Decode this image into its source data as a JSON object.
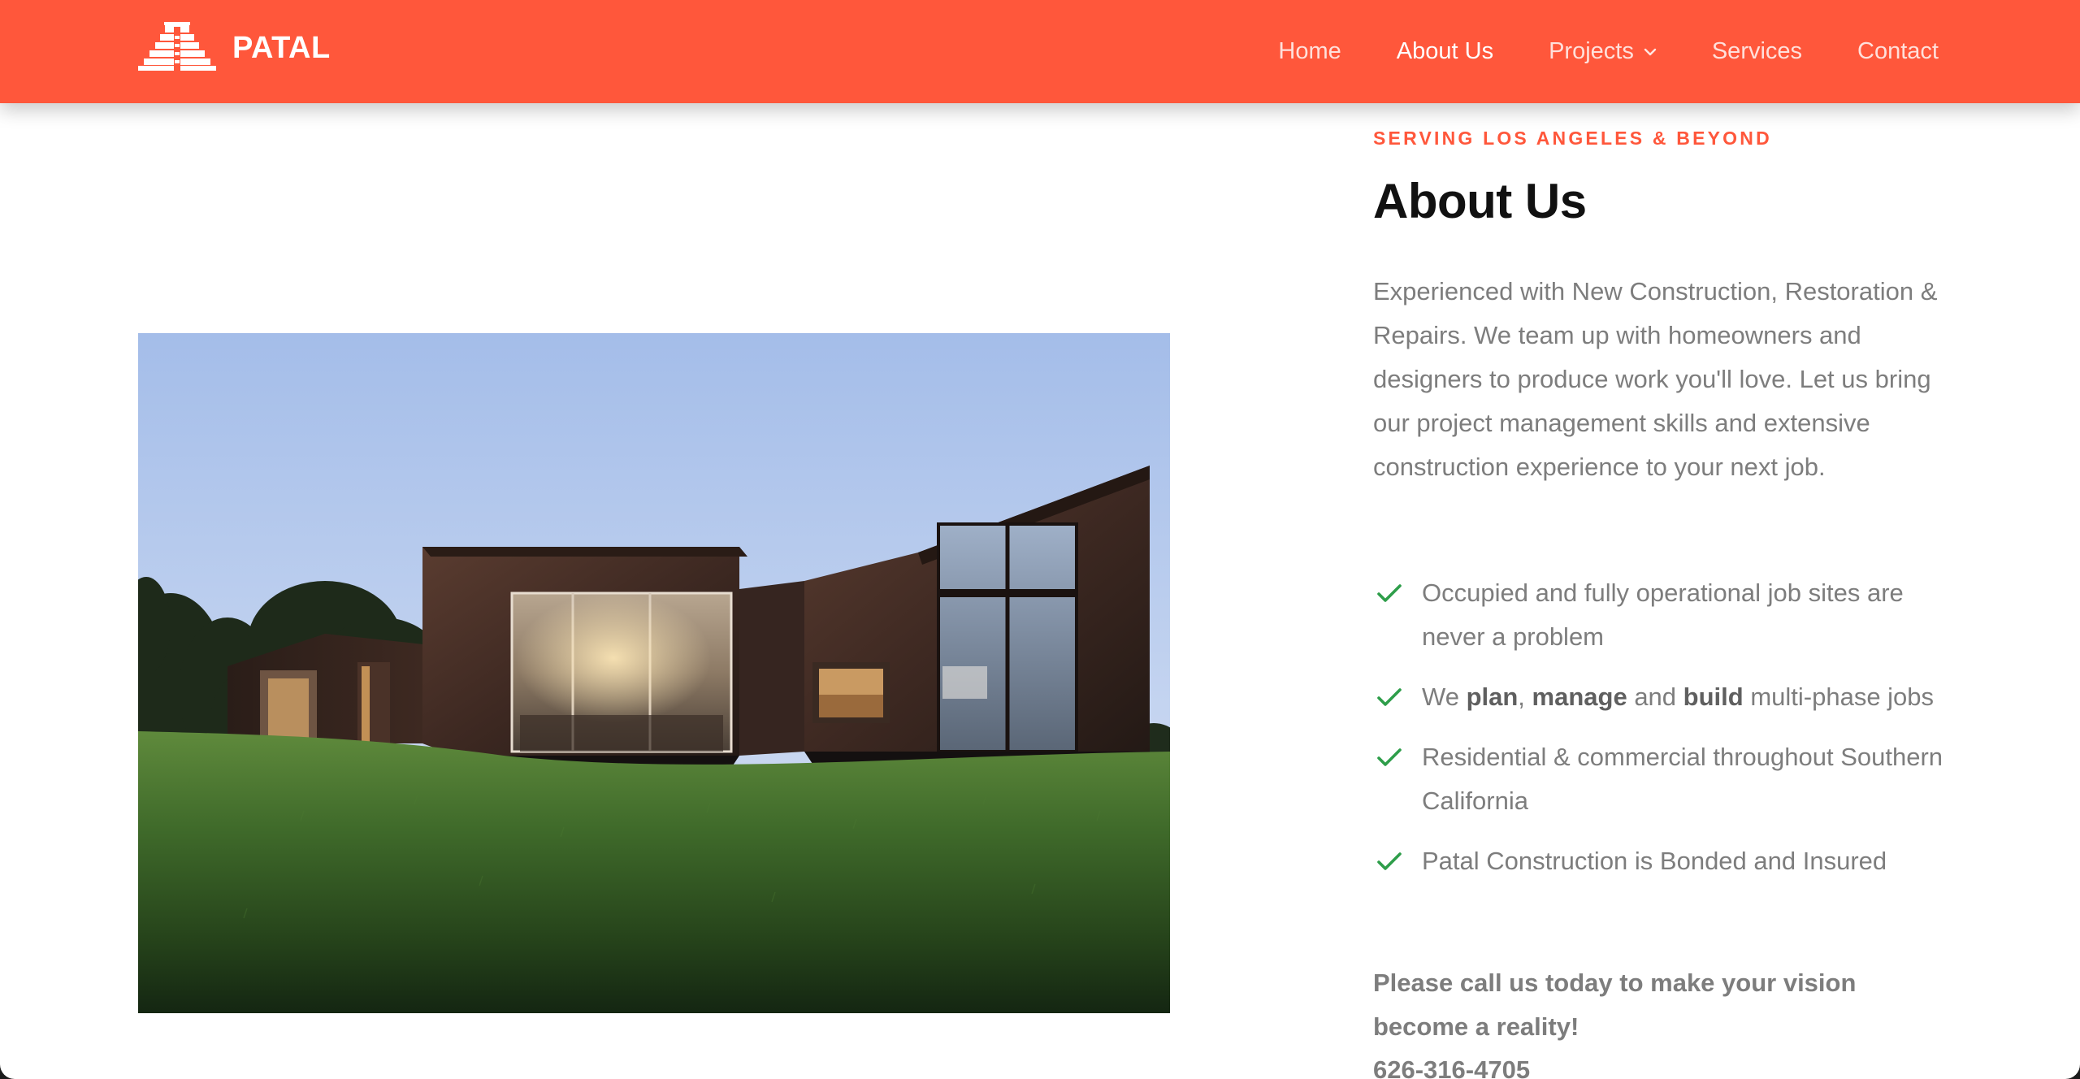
{
  "brand": {
    "name": "PATAL",
    "logo_icon": "pyramid-logo-icon",
    "color": "#ff573b"
  },
  "nav": {
    "items": [
      {
        "label": "Home",
        "active": false
      },
      {
        "label": "About Us",
        "active": true
      },
      {
        "label": "Projects",
        "active": false,
        "has_dropdown": true,
        "dropdown_icon": "chevron-down-icon"
      },
      {
        "label": "Services",
        "active": false
      },
      {
        "label": "Contact",
        "active": false
      }
    ]
  },
  "hero_image": {
    "subject": "modern dark-clad house on grassy hill at dusk"
  },
  "about": {
    "eyebrow": "SERVING LOS ANGELES & BEYOND",
    "title": "About Us",
    "intro": "Experienced with New Construction, Restoration & Repairs. We team up with homeowners and designers to produce work you'll love. Let us bring our project management skills and extensive construction experience to your next job.",
    "checklist_icon": "checkmark-icon",
    "check_color": "#2e9e4a",
    "checklist": [
      {
        "text": "Occupied and fully operational job sites are never a problem"
      },
      {
        "parts": [
          "We ",
          "plan",
          ", ",
          "manage",
          " and ",
          "build",
          " multi-phase jobs"
        ]
      },
      {
        "text": "Residential & commercial throughout Southern California"
      },
      {
        "text": "Patal Construction is Bonded and Insured"
      }
    ],
    "cta": "Please call us today to make your vision become a reality!",
    "phone": "626-316-4705"
  }
}
